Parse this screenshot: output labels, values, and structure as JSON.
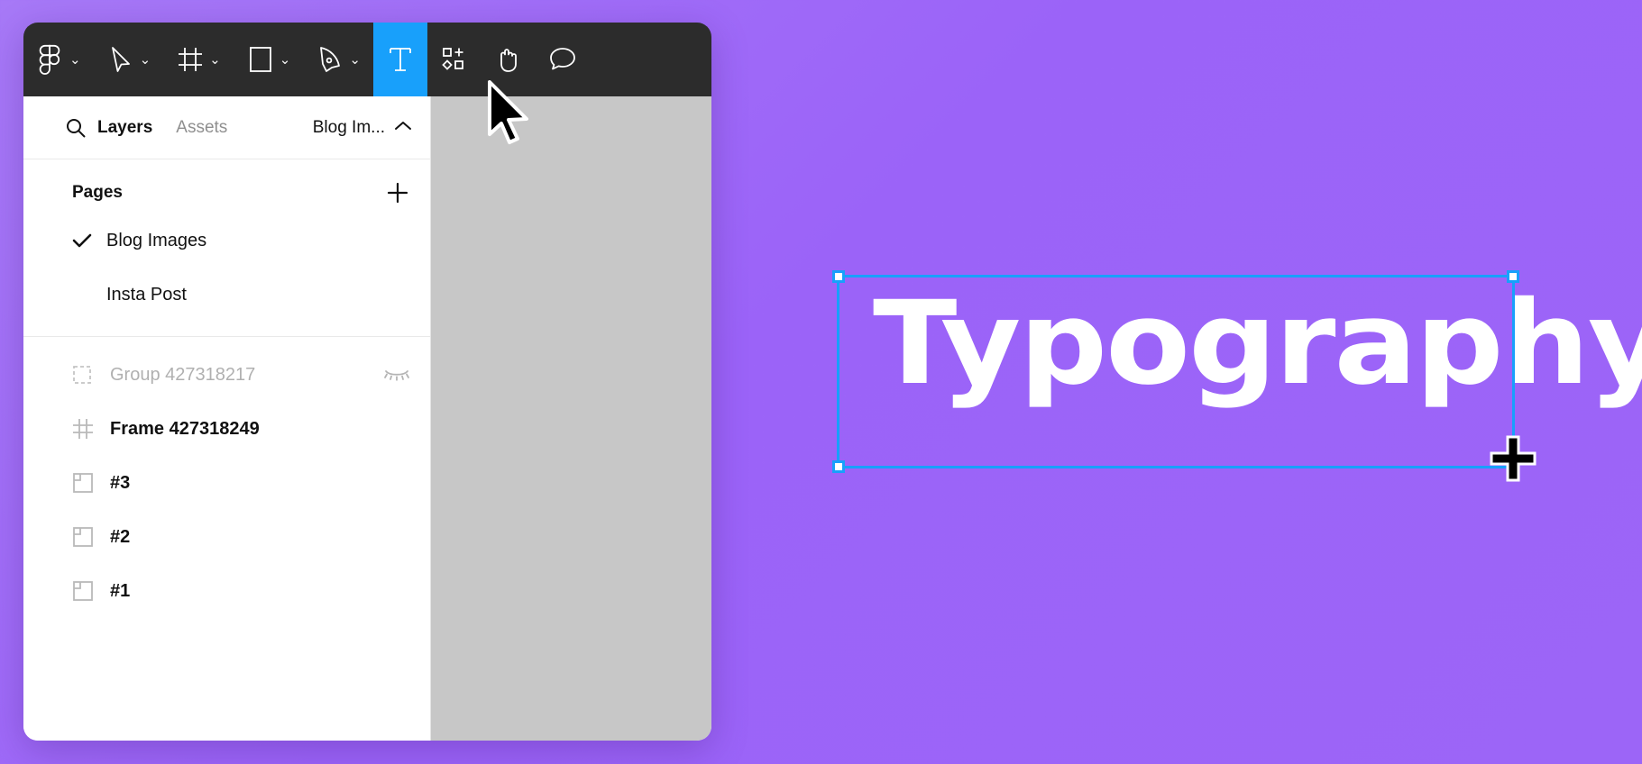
{
  "app": {
    "name": "Figma",
    "background_gradient_from": "#a779f7",
    "background_gradient_to": "#9c65f7",
    "accent_blue": "#18a0fb",
    "toolbar_bg": "#2c2c2c",
    "canvas_gray": "#c7c7c7"
  },
  "toolbar": {
    "tools": [
      {
        "id": "figma-menu",
        "icon": "figma-logo-icon",
        "label": "Main menu",
        "has_caret": true,
        "active": false
      },
      {
        "id": "move",
        "icon": "cursor-arrow-icon",
        "label": "Move",
        "has_caret": true,
        "active": false
      },
      {
        "id": "frame",
        "icon": "frame-icon",
        "label": "Frame",
        "has_caret": true,
        "active": false
      },
      {
        "id": "shape",
        "icon": "rectangle-icon",
        "label": "Shape",
        "has_caret": true,
        "active": false
      },
      {
        "id": "pen",
        "icon": "pen-icon",
        "label": "Pen",
        "has_caret": true,
        "active": false
      },
      {
        "id": "text",
        "icon": "text-tool-icon",
        "label": "Text",
        "has_caret": false,
        "active": true
      },
      {
        "id": "resources",
        "icon": "components-plus-icon",
        "label": "Resources",
        "has_caret": false,
        "active": false
      },
      {
        "id": "hand",
        "icon": "hand-icon",
        "label": "Hand tool",
        "has_caret": false,
        "active": false
      },
      {
        "id": "comment",
        "icon": "comment-bubble-icon",
        "label": "Add comment",
        "has_caret": false,
        "active": false
      }
    ]
  },
  "panel": {
    "search_icon": "search-icon",
    "tabs": [
      {
        "label": "Layers",
        "selected": true
      },
      {
        "label": "Assets",
        "selected": false
      }
    ],
    "file_chip": {
      "label": "Blog Im...",
      "caret_icon": "chevron-up-icon"
    },
    "pages": {
      "title": "Pages",
      "add_icon": "plus-icon",
      "items": [
        {
          "label": "Blog Images",
          "current": true,
          "check_icon": "check-icon"
        },
        {
          "label": "Insta Post",
          "current": false,
          "check_icon": ""
        }
      ]
    },
    "layers": [
      {
        "name": "Group 427318217",
        "icon": "group-dashed-icon",
        "hidden": true,
        "visibility_icon": "eye-closed-icon"
      },
      {
        "name": "Frame 427318249",
        "icon": "frame-hash-icon",
        "hidden": false,
        "visibility_icon": ""
      },
      {
        "name": "#3",
        "icon": "section-icon",
        "hidden": false,
        "visibility_icon": ""
      },
      {
        "name": "#2",
        "icon": "section-icon",
        "hidden": false,
        "visibility_icon": ""
      },
      {
        "name": "#1",
        "icon": "section-icon",
        "hidden": false,
        "visibility_icon": ""
      }
    ]
  },
  "canvas": {
    "text_layer": {
      "content": "Typography",
      "color": "#ffffff"
    },
    "selection": {
      "stroke_color": "#18a0fb",
      "handle_fill": "#ffffff"
    },
    "cursors": [
      {
        "type": "arrow-cursor",
        "over": "toolbar"
      },
      {
        "type": "crosshair-cursor",
        "over": "canvas"
      }
    ]
  }
}
